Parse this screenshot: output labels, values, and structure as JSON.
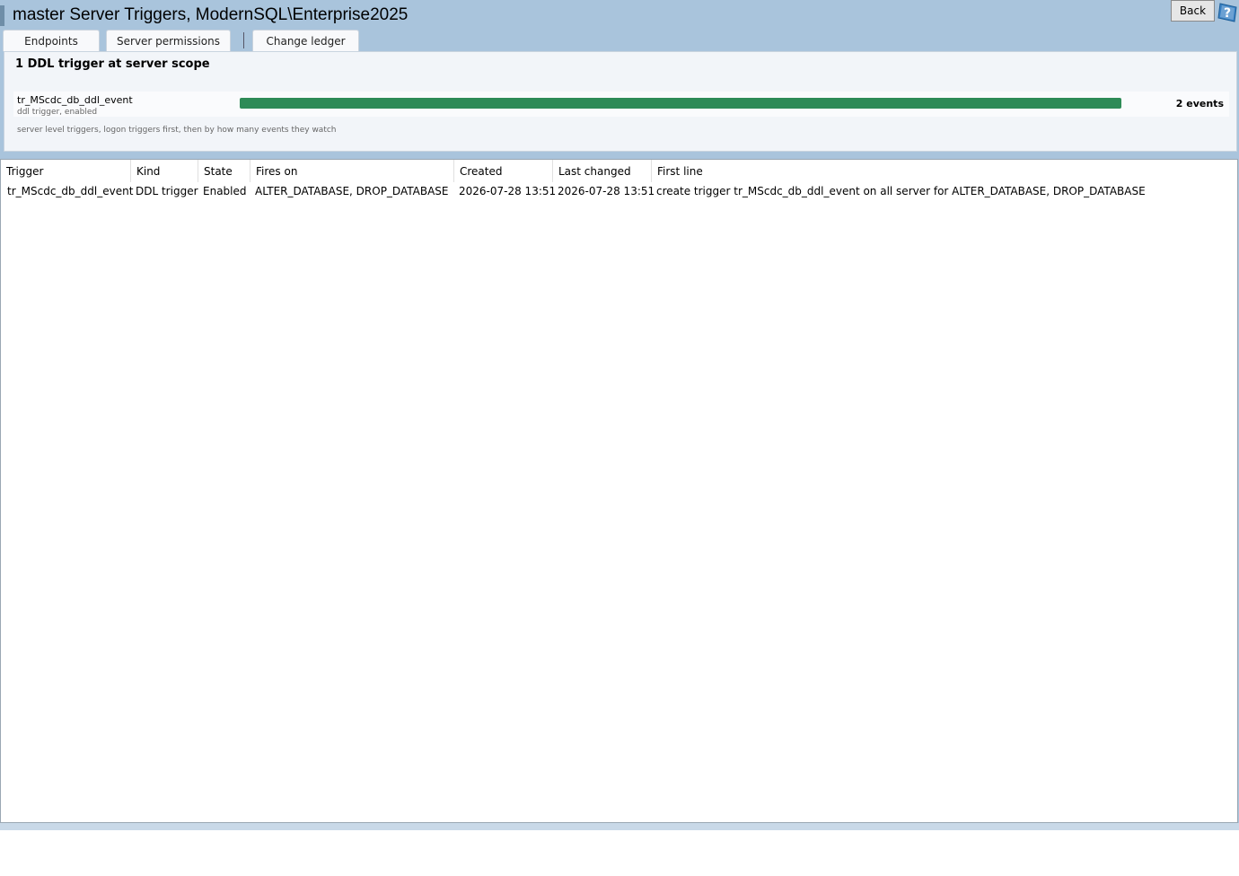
{
  "window": {
    "title": "master Server Triggers, ModernSQL\\Enterprise2025",
    "back_label": "Back",
    "help_icon": "help-icon"
  },
  "tabs": [
    {
      "label": "Endpoints"
    },
    {
      "label": "Server permissions"
    },
    {
      "label": "Change ledger"
    }
  ],
  "summary": {
    "title": "1 DDL trigger at server scope",
    "triggers": [
      {
        "name": "tr_MScdc_db_ddl_event",
        "subtitle": "ddl trigger, enabled",
        "events_label": "2 events",
        "events": 2,
        "bar_fraction": 1.0,
        "bar_color": "#2e8b57"
      }
    ],
    "note": "server level triggers, logon triggers first, then by how many events they watch"
  },
  "grid": {
    "columns": [
      "Trigger",
      "Kind",
      "State",
      "Fires on",
      "Created",
      "Last changed",
      "First line"
    ],
    "rows": [
      [
        "tr_MScdc_db_ddl_event",
        "DDL trigger",
        "Enabled",
        "ALTER_DATABASE, DROP_DATABASE",
        "2026-07-28 13:51",
        "2026-07-28 13:51",
        "create trigger tr_MScdc_db_ddl_event on all server for ALTER_DATABASE, DROP_DATABASE"
      ]
    ]
  }
}
